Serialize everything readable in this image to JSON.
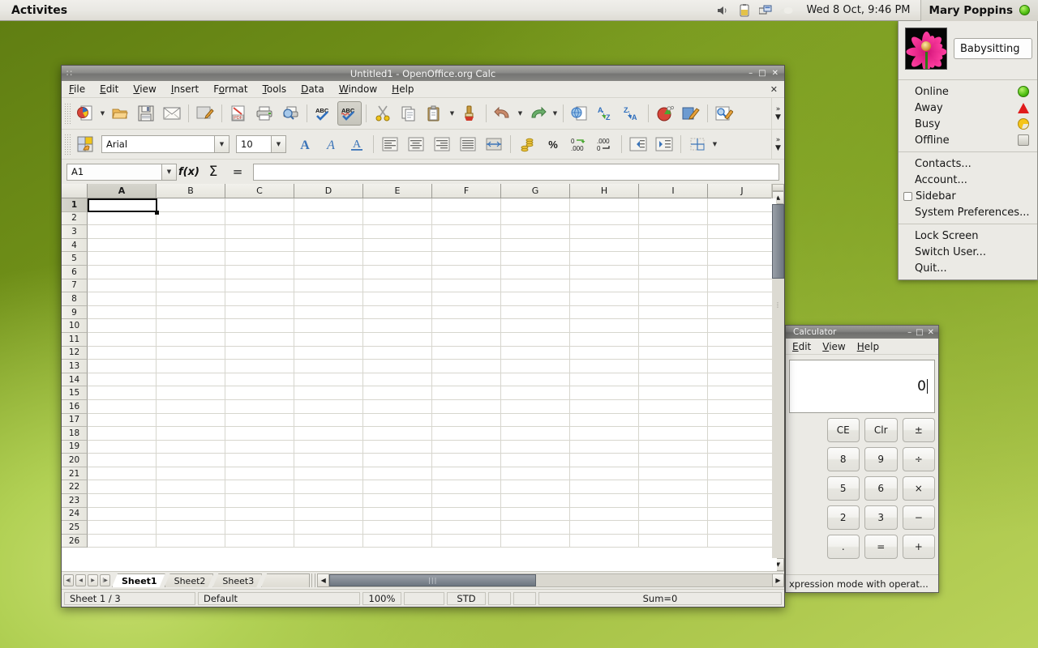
{
  "top_panel": {
    "activities_label": "Activites",
    "clock": "Wed 8 Oct, 9:46 PM",
    "user_name": "Mary Poppins",
    "tray_icons": [
      "volume-icon",
      "battery-icon",
      "network-icon",
      "weather-icon"
    ]
  },
  "user_menu": {
    "nickname": "Babysitting",
    "presence": [
      {
        "label": "Online",
        "icon": "online-status-icon"
      },
      {
        "label": "Away",
        "icon": "away-status-icon"
      },
      {
        "label": "Busy",
        "icon": "busy-status-icon"
      },
      {
        "label": "Offline",
        "icon": "offline-status-icon"
      }
    ],
    "actions": [
      {
        "label": "Contacts..."
      },
      {
        "label": "Account..."
      },
      {
        "label": "Sidebar",
        "checkbox": true,
        "checked": false
      },
      {
        "label": "System Preferences..."
      }
    ],
    "session": [
      {
        "label": "Lock Screen"
      },
      {
        "label": "Switch User..."
      },
      {
        "label": "Quit..."
      }
    ]
  },
  "calc_window": {
    "title": "Untitled1 - OpenOffice.org Calc",
    "menu": [
      "File",
      "Edit",
      "View",
      "Insert",
      "Format",
      "Tools",
      "Data",
      "Window",
      "Help"
    ],
    "title_buttons": [
      "minimize",
      "maximize",
      "close"
    ],
    "menubar_close": "✕",
    "standard_toolbar": [
      "new-document-icon",
      "new-dropdown",
      "open-icon",
      "save-icon",
      "email-icon",
      "sep",
      "edit-file-icon",
      "sep",
      "export-pdf-icon",
      "print-icon",
      "print-preview-icon",
      "sep",
      "spelling-icon",
      "autospellcheck-icon",
      "sep",
      "cut-icon",
      "copy-icon",
      "paste-icon",
      "paste-dropdown",
      "clone-formatting-icon",
      "sep",
      "undo-icon",
      "undo-dropdown",
      "redo-icon",
      "redo-dropdown",
      "sep",
      "hyperlink-icon",
      "sort-ascending-icon",
      "sort-descending-icon",
      "sep",
      "chart-icon",
      "draw-functions-icon",
      "sep",
      "find-replace-icon"
    ],
    "format_toolbar": {
      "styles_icon": "styles-and-formatting-icon",
      "font_name": "Arial",
      "font_size": "10",
      "buttons": [
        "bold-icon",
        "italic-icon",
        "underline-icon",
        "sep",
        "align-left-icon",
        "align-center-icon",
        "align-right-icon",
        "align-justified-icon",
        "merge-cells-icon",
        "sep",
        "currency-format-icon",
        "percent-format-icon",
        "add-decimal-icon",
        "delete-decimal-icon",
        "sep",
        "decrease-indent-icon",
        "increase-indent-icon",
        "sep",
        "borders-icon",
        "borders-dropdown"
      ]
    },
    "formula_bar": {
      "name_box": "A1",
      "function_wizard_icon": "f(x)",
      "sum_icon": "Σ",
      "formula_icon": "=",
      "input_line": ""
    },
    "grid": {
      "columns": [
        "A",
        "B",
        "C",
        "D",
        "E",
        "F",
        "G",
        "H",
        "I",
        "J"
      ],
      "rows": [
        1,
        2,
        3,
        4,
        5,
        6,
        7,
        8,
        9,
        10,
        11,
        12,
        13,
        14,
        15,
        16,
        17,
        18,
        19,
        20,
        21,
        22,
        23,
        24,
        25,
        26
      ],
      "selected_cell": "A1",
      "selected_column": "A",
      "selected_row": 1
    },
    "sheet_tabs": {
      "nav_buttons": [
        "first-sheet",
        "previous-sheet",
        "next-sheet",
        "last-sheet"
      ],
      "tabs": [
        "Sheet1",
        "Sheet2",
        "Sheet3"
      ],
      "active": "Sheet1"
    },
    "status_bar": {
      "sheet_info": "Sheet 1 / 3",
      "page_style": "Default",
      "zoom": "100%",
      "blank1": "",
      "selection_mode": "STD",
      "modified": "",
      "signature": "",
      "sum": "Sum=0"
    }
  },
  "calculator_window": {
    "title": "Calculator",
    "title_buttons": [
      "minimize",
      "maximize",
      "close"
    ],
    "menu": [
      "Edit",
      "View",
      "Help"
    ],
    "display": "0",
    "buttons": [
      [
        "CE",
        "Clr",
        "±"
      ],
      [
        "8",
        "9",
        "÷"
      ],
      [
        "5",
        "6",
        "×"
      ],
      [
        "2",
        "3",
        "−"
      ],
      [
        ".",
        "=",
        "+"
      ]
    ],
    "status": "xpression mode with operat..."
  }
}
